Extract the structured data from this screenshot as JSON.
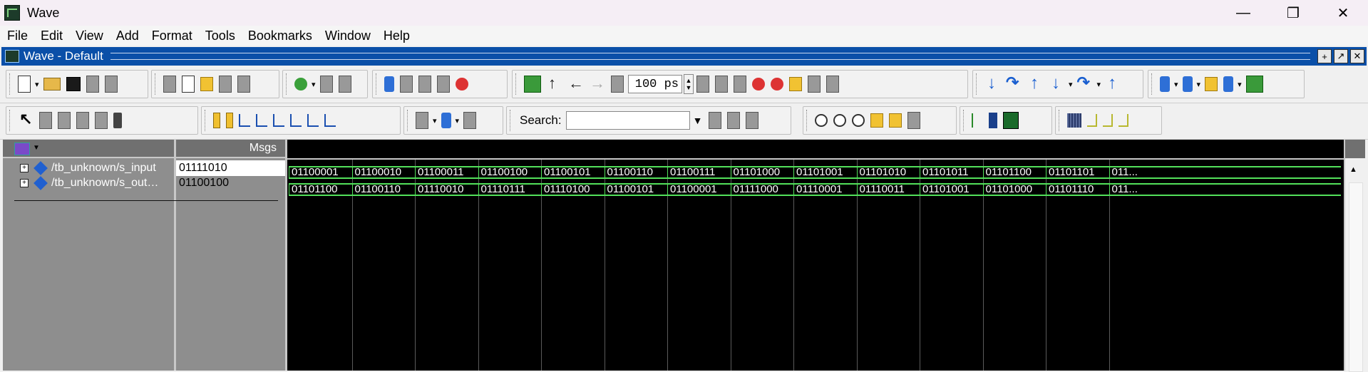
{
  "window": {
    "title": "Wave",
    "minimize": "—",
    "maximize": "❐",
    "close": "✕"
  },
  "menu": [
    "File",
    "Edit",
    "View",
    "Add",
    "Format",
    "Tools",
    "Bookmarks",
    "Window",
    "Help"
  ],
  "panel": {
    "title": "Wave - Default"
  },
  "toolbar": {
    "time_value": "100 ps",
    "search_label": "Search:",
    "search_value": ""
  },
  "waves": {
    "header_msgs": "Msgs",
    "signals": [
      {
        "name": "/tb_unknown/s_input",
        "value": "01111010",
        "expander": "+",
        "segments": [
          "01100001",
          "01100010",
          "01100011",
          "01100100",
          "01100101",
          "01100110",
          "01100111",
          "01101000",
          "01101001",
          "01101010",
          "01101011",
          "01101100",
          "01101101",
          "011..."
        ]
      },
      {
        "name": "/tb_unknown/s_out…",
        "value": "01100100",
        "expander": "+",
        "segments": [
          "01101100",
          "01100110",
          "01110010",
          "01110111",
          "01110100",
          "01100101",
          "01100001",
          "01111000",
          "01110001",
          "01110011",
          "01101001",
          "01101000",
          "01101110",
          "011..."
        ]
      }
    ]
  },
  "colors": {
    "bus_green": "#52e05a",
    "wave_bg": "#000000",
    "panel_blue": "#0a4fa8"
  }
}
